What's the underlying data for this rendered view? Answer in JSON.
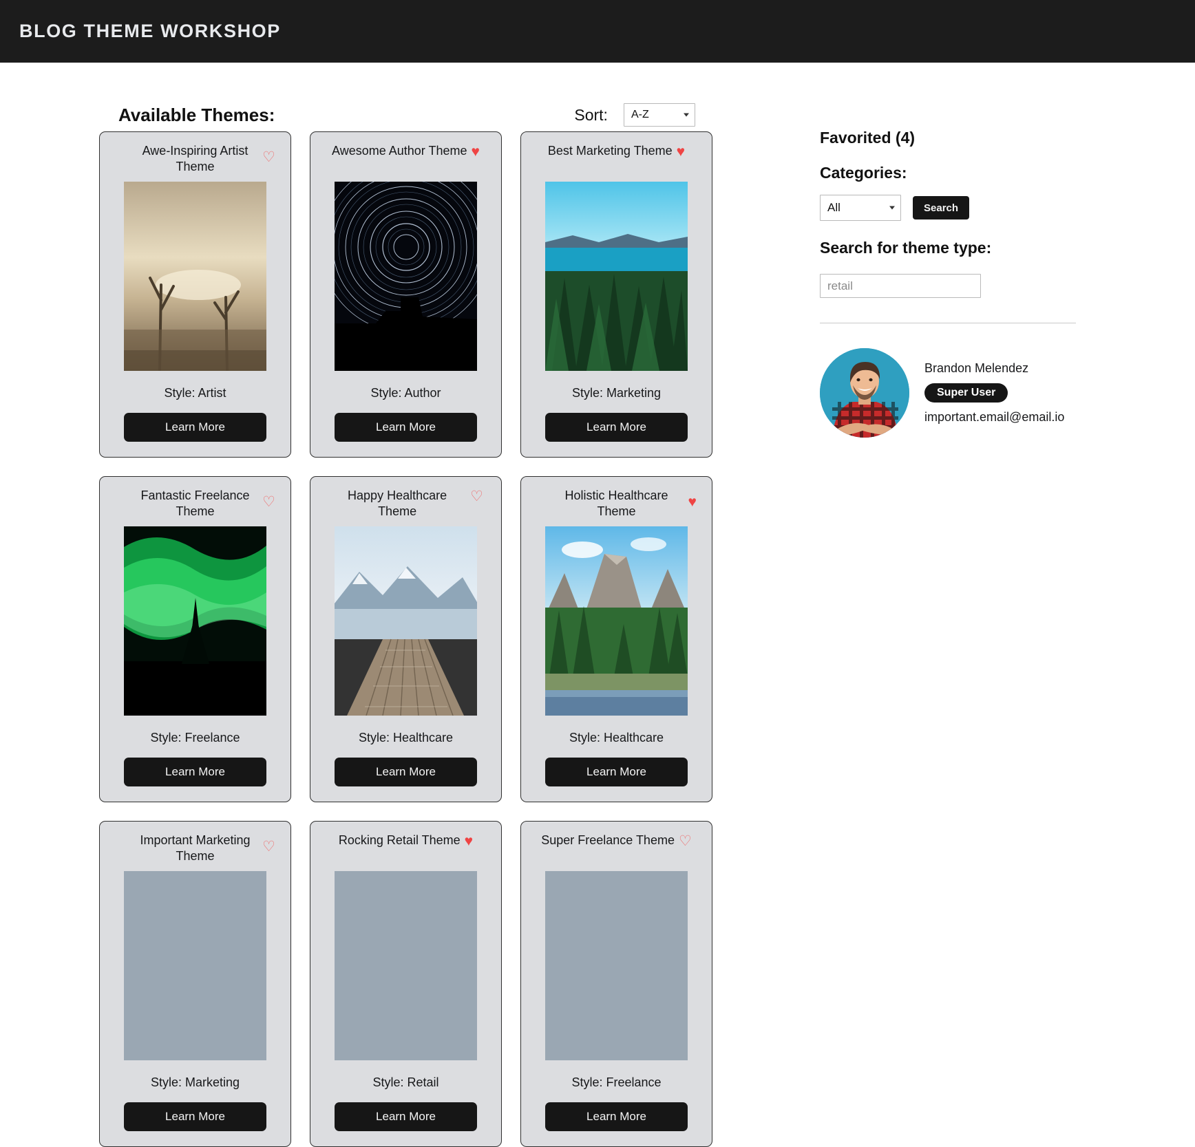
{
  "header": {
    "title": "Blog Theme Workshop"
  },
  "main": {
    "section_title": "Available Themes:",
    "sort_label": "Sort:",
    "sort_value": "A-Z",
    "learn_more_label": "Learn More",
    "cards": [
      {
        "title": "Awe-Inspiring Artist Theme",
        "style": "Style: Artist",
        "favorited": false,
        "img": "dead-trees-sepia-desert"
      },
      {
        "title": "Awesome Author Theme",
        "style": "Style: Author",
        "favorited": true,
        "img": "night-star-trails"
      },
      {
        "title": "Best Marketing Theme",
        "style": "Style: Marketing",
        "favorited": true,
        "img": "lake-forest-blue"
      },
      {
        "title": "Fantastic Freelance Theme",
        "style": "Style: Freelance",
        "favorited": false,
        "img": "green-aurora-tree"
      },
      {
        "title": "Happy Healthcare Theme",
        "style": "Style: Healthcare",
        "favorited": false,
        "img": "wooden-dock-mountain-lake"
      },
      {
        "title": "Holistic Healthcare Theme",
        "style": "Style: Healthcare",
        "favorited": true,
        "img": "yosemite-valley-cliffs"
      },
      {
        "title": "Important Marketing Theme",
        "style": "Style: Marketing",
        "favorited": false,
        "img": "marketing-placeholder"
      },
      {
        "title": "Rocking Retail Theme",
        "style": "Style: Retail",
        "favorited": true,
        "img": "retail-placeholder"
      },
      {
        "title": "Super Freelance Theme",
        "style": "Style: Freelance",
        "favorited": false,
        "img": "freelance-placeholder"
      }
    ]
  },
  "sidebar": {
    "favorited_label": "Favorited (4)",
    "categories_label": "Categories:",
    "category_value": "All",
    "search_button": "Search",
    "theme_type_label": "Search for theme type:",
    "theme_type_placeholder": "retail",
    "profile": {
      "name": "Brandon Melendez",
      "badge": "Super User",
      "email": "important.email@email.io"
    }
  },
  "icons": {
    "heart_filled": "♥",
    "heart_outline": "♡"
  }
}
